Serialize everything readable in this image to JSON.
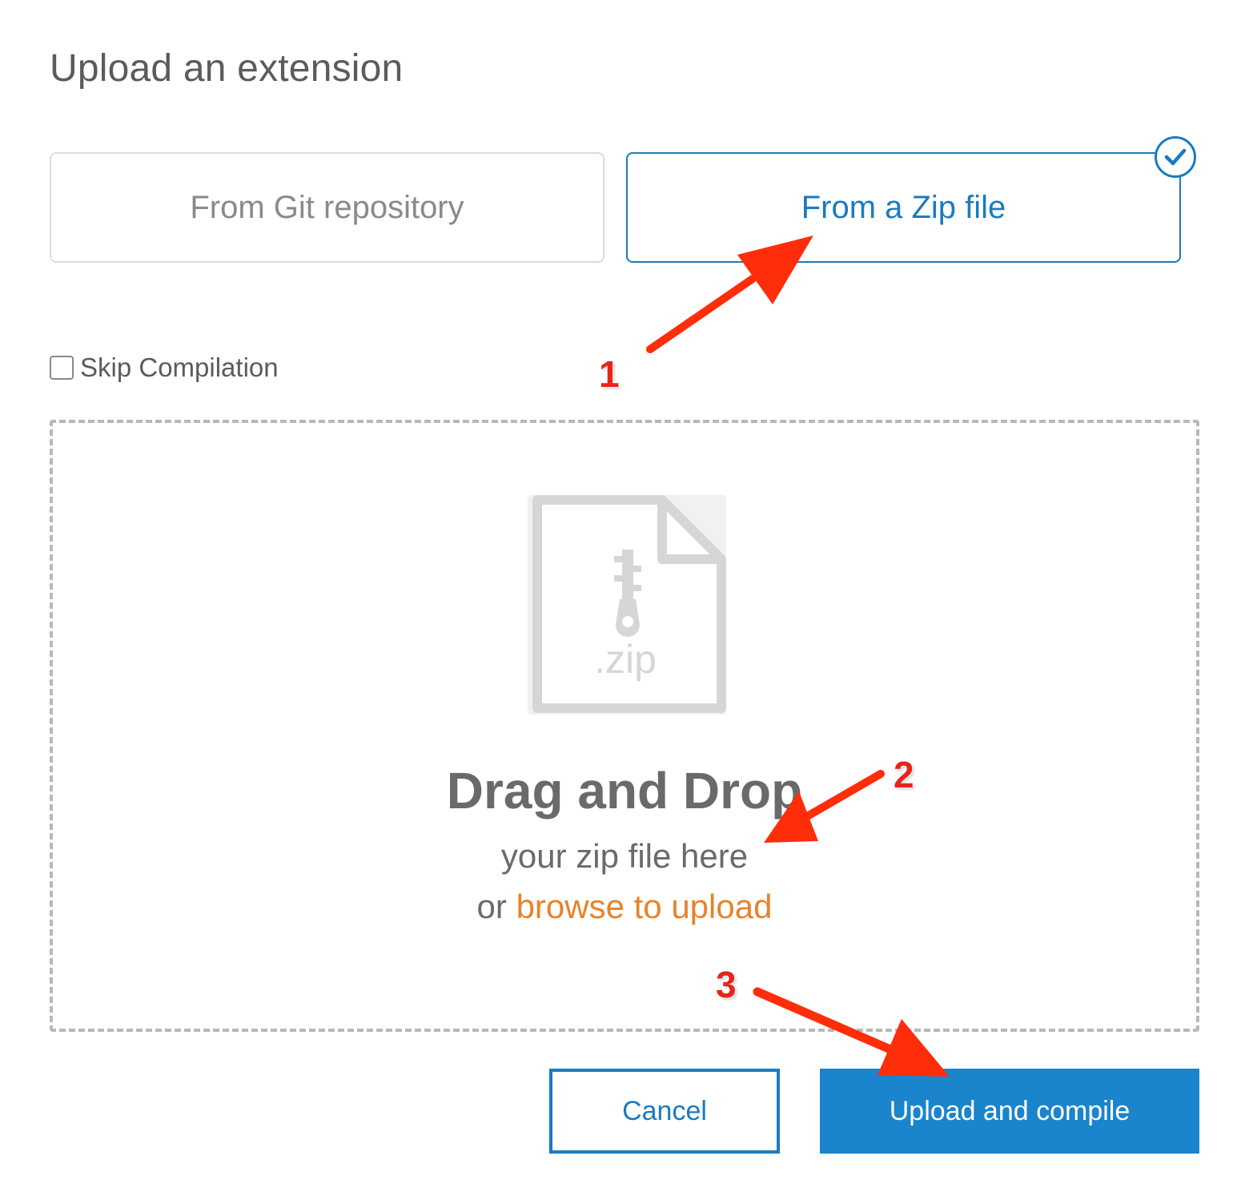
{
  "dialog": {
    "title": "Upload an extension"
  },
  "source_options": [
    {
      "label": "From Git repository",
      "selected": false
    },
    {
      "label": "From a Zip file",
      "selected": true
    }
  ],
  "skip_compilation": {
    "label": "Skip Compilation",
    "checked": false
  },
  "dropzone": {
    "icon": "zip-file-icon",
    "icon_text": ".zip",
    "title": "Drag and Drop",
    "subtitle": "your zip file here",
    "browse_prefix": "or",
    "browse_link": "browse to upload"
  },
  "buttons": {
    "cancel": "Cancel",
    "upload": "Upload and compile"
  },
  "annotations": {
    "step1": "1",
    "step2": "2",
    "step3": "3",
    "arrow_color": "#ff2d0a"
  },
  "colors": {
    "accent": "#1a7bbf",
    "primary_button": "#1a84cc",
    "link": "#e8832a"
  }
}
